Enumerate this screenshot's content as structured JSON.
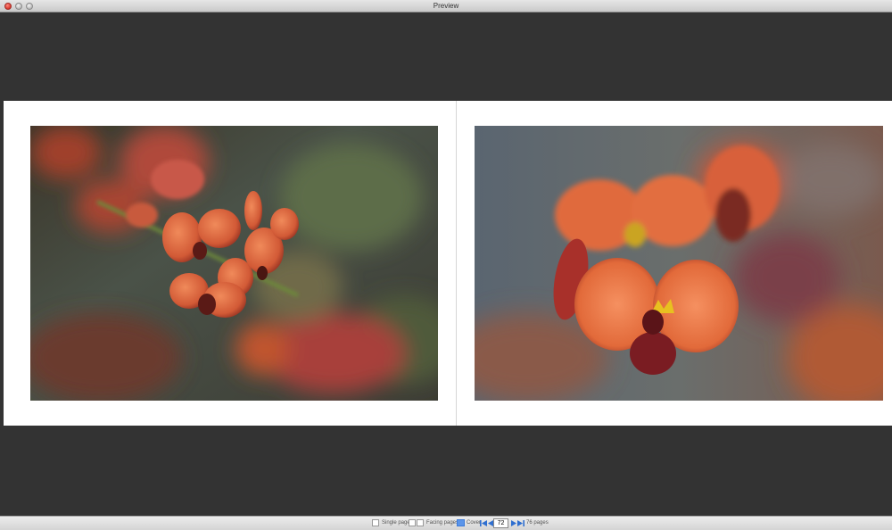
{
  "window": {
    "title": "Preview"
  },
  "colors": {
    "background": "#333333",
    "page": "#ffffff",
    "accent": "#2f6fd0"
  },
  "spread": {
    "left_photo": {
      "subject": "orange-red pea flowers cluster",
      "icon": "photo-left"
    },
    "right_photo": {
      "subject": "single orange pea flower close-up",
      "icon": "photo-right"
    }
  },
  "toolbar": {
    "single_page_label": "Single page",
    "facing_pages_label": "Facing pages",
    "cover_label": "Cover",
    "current_page": "72",
    "total_pages_label": "76 pages"
  }
}
